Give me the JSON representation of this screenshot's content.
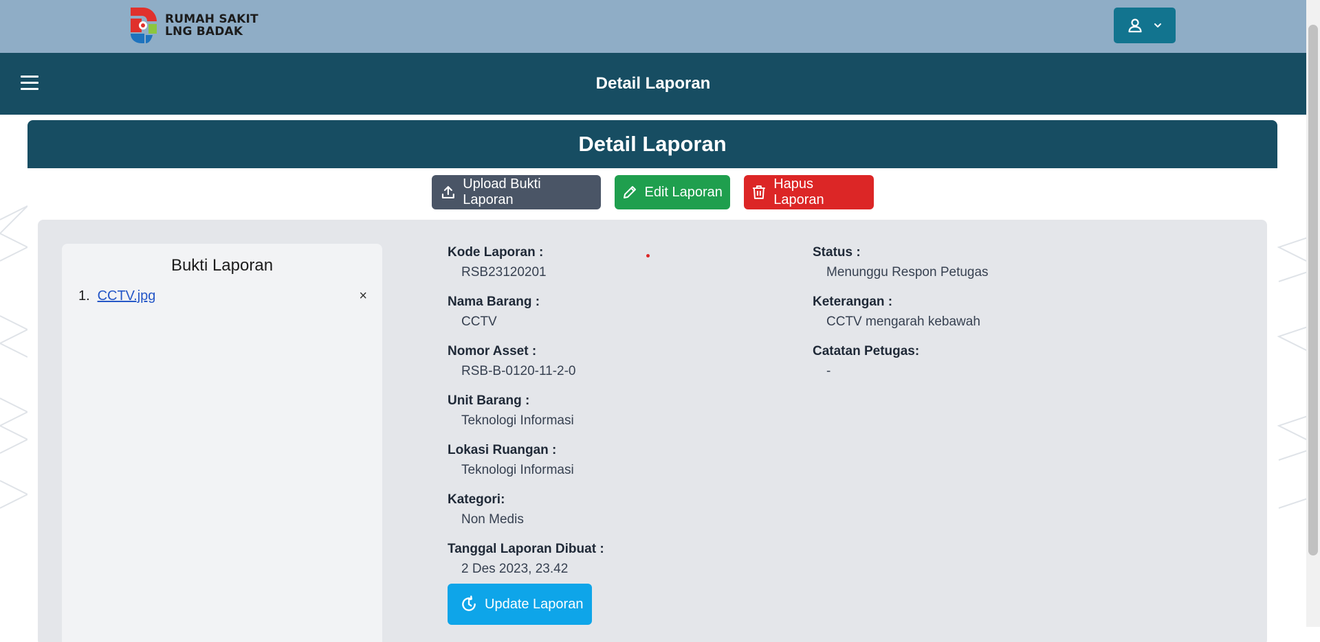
{
  "brand": {
    "line1": "RUMAH SAKIT",
    "line2": "LNG BADAK"
  },
  "nav": {
    "title": "Detail Laporan"
  },
  "card": {
    "title": "Detail Laporan"
  },
  "actions": {
    "upload_label": "Upload Bukti Laporan",
    "edit_label": "Edit Laporan",
    "delete_label": "Hapus Laporan",
    "update_label": "Update Laporan"
  },
  "bukti": {
    "title": "Bukti Laporan",
    "items": [
      {
        "num": "1.",
        "name": "CCTV.jpg",
        "remove": "×"
      }
    ]
  },
  "details_left": [
    {
      "label": "Kode Laporan :",
      "value": "RSB23120201"
    },
    {
      "label": "Nama Barang :",
      "value": "CCTV"
    },
    {
      "label": "Nomor Asset :",
      "value": "RSB-B-0120-11-2-0"
    },
    {
      "label": "Unit Barang :",
      "value": "Teknologi Informasi"
    },
    {
      "label": "Lokasi Ruangan :",
      "value": "Teknologi Informasi"
    },
    {
      "label": "Kategori:",
      "value": "Non Medis"
    },
    {
      "label": "Tanggal Laporan Dibuat :",
      "value": "2 Des 2023, 23.42"
    }
  ],
  "details_right": [
    {
      "label": "Status :",
      "value": "Menunggu Respon Petugas"
    },
    {
      "label": "Keterangan :",
      "value": "CCTV mengarah kebawah"
    },
    {
      "label": "Catatan Petugas:",
      "value": "-"
    }
  ],
  "colors": {
    "topbar": "#8fadc6",
    "navbar": "#174d62",
    "gray_button": "#4a5566",
    "green_button": "#1f9f4e",
    "red_button": "#dc2626",
    "blue_button": "#0ea5e9"
  },
  "icons": {
    "user": "user-icon",
    "dropdown": "chevron-down-icon",
    "menu": "hamburger-menu-icon",
    "upload": "upload-icon",
    "edit": "pencil-icon",
    "delete": "trash-icon",
    "update": "refresh-icon"
  }
}
